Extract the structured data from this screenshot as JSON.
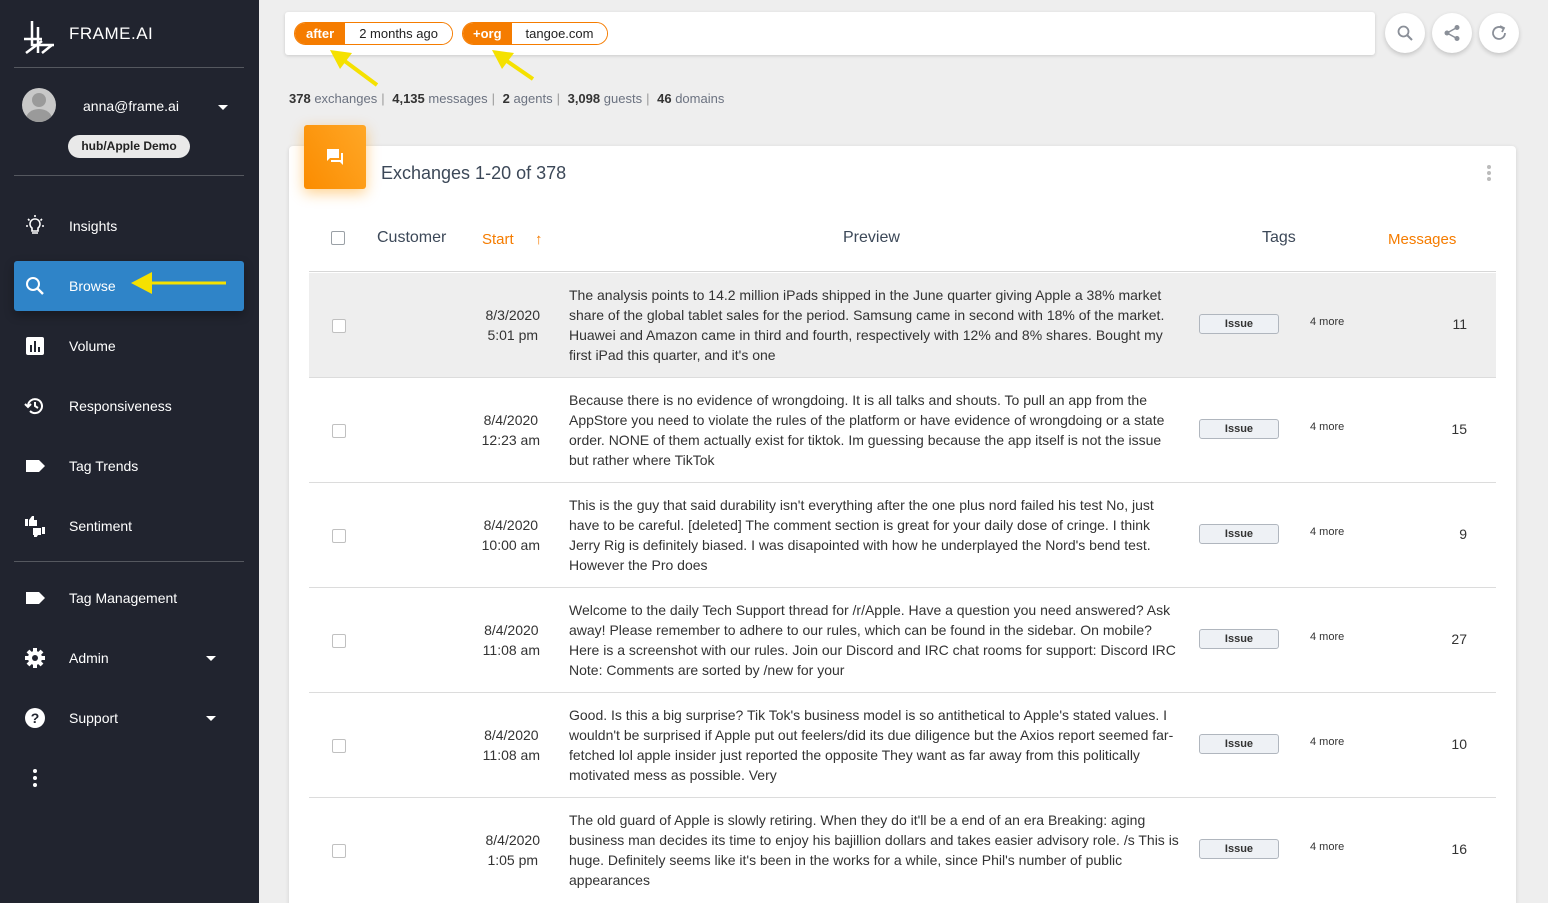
{
  "sidebar": {
    "brand": "FRAME.AI",
    "user_email": "anna@frame.ai",
    "hub": "hub/Apple Demo",
    "nav": [
      {
        "label": "Insights",
        "icon": "lightbulb-icon"
      },
      {
        "label": "Browse",
        "icon": "search-icon",
        "active": true
      },
      {
        "label": "Volume",
        "icon": "bar-chart-icon"
      },
      {
        "label": "Responsiveness",
        "icon": "history-icon"
      },
      {
        "label": "Tag Trends",
        "icon": "label-icon"
      },
      {
        "label": "Sentiment",
        "icon": "thumbs-icon"
      }
    ],
    "nav2": [
      {
        "label": "Tag Management",
        "icon": "label-icon"
      },
      {
        "label": "Admin",
        "icon": "gear-icon"
      },
      {
        "label": "Support",
        "icon": "help-icon"
      }
    ]
  },
  "filters": [
    {
      "key": "after",
      "value": "2 months ago"
    },
    {
      "key": "+org",
      "value": "tangoe.com"
    }
  ],
  "stats": {
    "exchanges_n": "378",
    "exchanges_l": "exchanges",
    "messages_n": "4,135",
    "messages_l": "messages",
    "agents_n": "2",
    "agents_l": "agents",
    "guests_n": "3,098",
    "guests_l": "guests",
    "domains_n": "46",
    "domains_l": "domains"
  },
  "card": {
    "title": "Exchanges 1-20 of 378",
    "columns": {
      "customer": "Customer",
      "start": "Start",
      "start_sort": "↑",
      "preview": "Preview",
      "tags": "Tags",
      "messages": "Messages"
    }
  },
  "rows": [
    {
      "date": "8/3/2020",
      "time": "5:01 pm",
      "preview": "The analysis points to 14.2 million iPads shipped in the June quarter giving Apple a 38% market share of the global tablet sales for the period. Samsung came in second with 18% of the market. Huawei and Amazon came in third and fourth, respectively with 12% and 8% shares. Bought my first iPad this quarter, and it's one",
      "tag": "Issue",
      "more": "4 more",
      "count": "11"
    },
    {
      "date": "8/4/2020",
      "time": "12:23 am",
      "preview": "Because there is no evidence of wrongdoing. It is all talks and shouts. To pull an app from the AppStore you need to violate the rules of the platform or have evidence of wrongdoing or a state order. NONE of them actually exist for tiktok. Im guessing because the app itself is not the issue but rather where TikTok",
      "tag": "Issue",
      "more": "4 more",
      "count": "15"
    },
    {
      "date": "8/4/2020",
      "time": "10:00 am",
      "preview": "This is the guy that said durability isn't everything after the one plus nord failed his test No, just have to be careful. [deleted] The comment section is great for your daily dose of cringe. I think Jerry Rig is definitely biased. I was disapointed with how he underplayed the Nord's bend test. However the Pro does",
      "tag": "Issue",
      "more": "4 more",
      "count": "9"
    },
    {
      "date": "8/4/2020",
      "time": "11:08 am",
      "preview": "Welcome to the daily Tech Support thread for /r/Apple. Have a question you need answered? Ask away! Please remember to adhere to our rules, which can be found in the sidebar. On mobile? Here is a screenshot with our rules. Join our Discord and IRC chat rooms for support: Discord IRC Note: Comments are sorted by /new for your",
      "tag": "Issue",
      "more": "4 more",
      "count": "27"
    },
    {
      "date": "8/4/2020",
      "time": "11:08 am",
      "preview": "Good. Is this a big surprise? Tik Tok's business model is so antithetical to Apple's stated values. I wouldn't be surprised if Apple put out feelers/did its due diligence but the Axios report seemed far-fetched lol apple insider just reported the opposite They want as far away from this politically motivated mess as possible. Very",
      "tag": "Issue",
      "more": "4 more",
      "count": "10"
    },
    {
      "date": "8/4/2020",
      "time": "1:05 pm",
      "preview": "The old guard of Apple is slowly retiring. When they do it'll be a end of an era Breaking: aging business man decides its time to enjoy his bajillion dollars and takes easier advisory role. /s This is huge. Definitely seems like it's been in the works for a while, since Phil's number of public appearances",
      "tag": "Issue",
      "more": "4 more",
      "count": "16"
    }
  ],
  "colors": {
    "sidebar_bg": "#21242f",
    "active_nav": "#2f84c8",
    "accent": "#f57c00",
    "annotation": "#f5e100"
  }
}
